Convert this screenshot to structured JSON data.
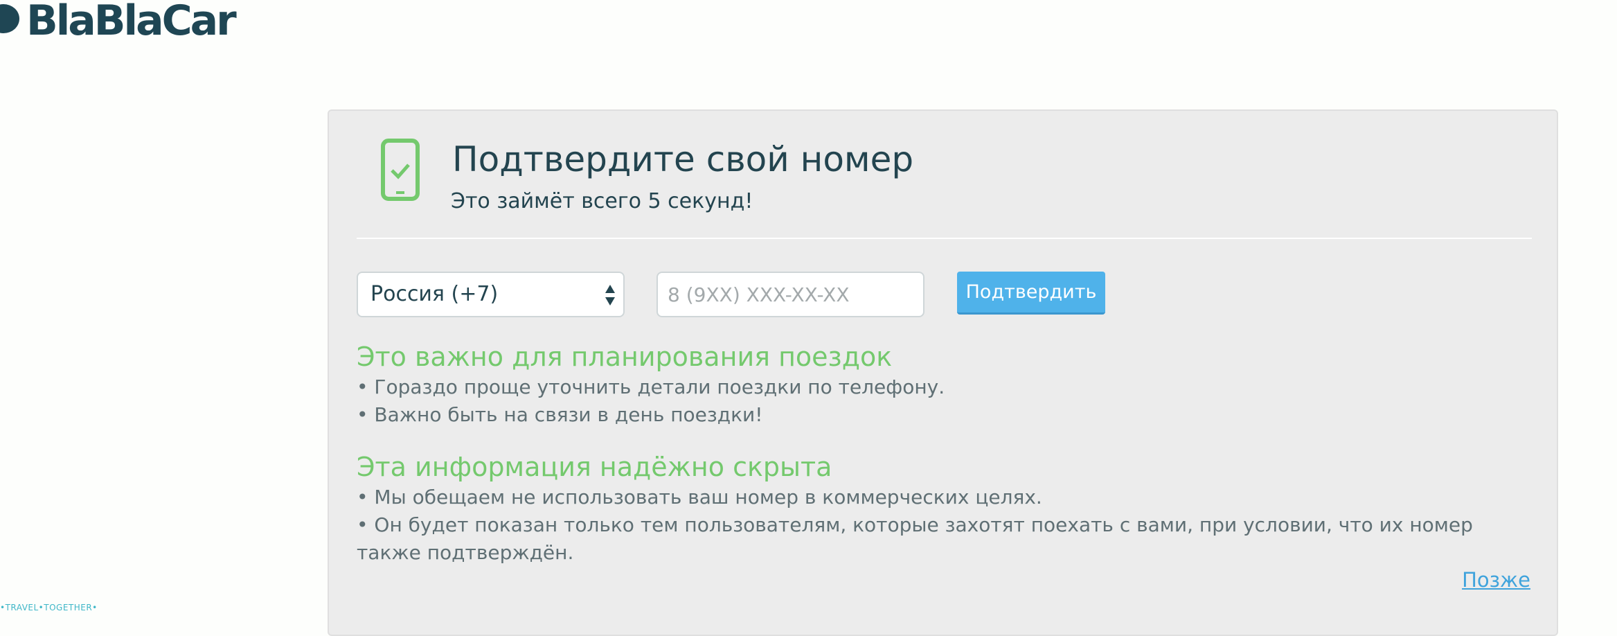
{
  "header": {
    "logo_text": "BlaBlaCar",
    "tagline": "•TRAVEL•TOGETHER•"
  },
  "dialog": {
    "title": "Подтвердите свой номер",
    "subtitle": "Это займёт всего 5 секунд!",
    "country_select": {
      "selected": "Россия (+7)"
    },
    "phone_input": {
      "value": "",
      "placeholder": "8 (9XX) XXX-XX-XX"
    },
    "confirm_label": "Подтвердить",
    "sections": [
      {
        "heading": "Это важно для планирования поездок",
        "bullets": [
          "• Гораздо проще уточнить детали поездки по телефону.",
          "• Важно быть на связи в день поездки!"
        ]
      },
      {
        "heading": "Эта информация надёжно скрыта",
        "bullets": [
          "• Мы обещаем не использовать ваш номер в коммерческих целях.",
          "• Он будет показан только тем пользователям, которые захотят поехать с вами, при условии, что их номер также подтверждён."
        ]
      }
    ],
    "later_link": "Позже"
  },
  "colors": {
    "brand_dark": "#1f4654",
    "accent_green": "#74c96d",
    "button_blue": "#4fb2ea",
    "link_blue": "#3fa3dc",
    "panel_bg": "#ececec"
  },
  "icons": {
    "phone": "phone-check-icon",
    "select_arrows": "sort-arrows-icon"
  }
}
